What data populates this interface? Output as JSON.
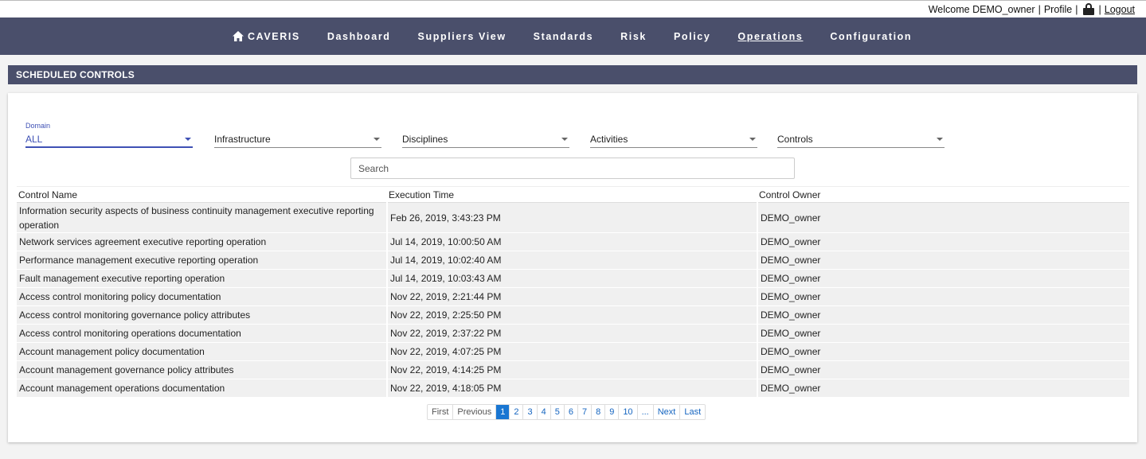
{
  "topbar": {
    "welcome": "Welcome DEMO_owner",
    "sep1": "|",
    "profile": "Profile",
    "sep2": "|",
    "sep3": "|",
    "logout": "Logout"
  },
  "nav": {
    "brand": "CAVERIS",
    "items": [
      {
        "label": "Dashboard"
      },
      {
        "label": "Suppliers View"
      },
      {
        "label": "Standards"
      },
      {
        "label": "Risk"
      },
      {
        "label": "Policy"
      },
      {
        "label": "Operations",
        "active": true
      },
      {
        "label": "Configuration"
      }
    ]
  },
  "section": {
    "title": "SCHEDULED CONTROLS"
  },
  "filters": {
    "domain": {
      "label": "Domain",
      "value": "ALL"
    },
    "infrastructure": {
      "value": "Infrastructure"
    },
    "disciplines": {
      "value": "Disciplines"
    },
    "activities": {
      "value": "Activities"
    },
    "controls": {
      "value": "Controls"
    }
  },
  "search": {
    "placeholder": "Search",
    "value": ""
  },
  "table": {
    "headers": [
      "Control Name",
      "Execution Time",
      "Control Owner"
    ],
    "rows": [
      [
        "Information security aspects of business continuity management executive reporting operation",
        "Feb 26, 2019, 3:43:23 PM",
        "DEMO_owner"
      ],
      [
        "Network services agreement executive reporting operation",
        "Jul 14, 2019, 10:00:50 AM",
        "DEMO_owner"
      ],
      [
        "Performance management executive reporting operation",
        "Jul 14, 2019, 10:02:40 AM",
        "DEMO_owner"
      ],
      [
        "Fault management executive reporting operation",
        "Jul 14, 2019, 10:03:43 AM",
        "DEMO_owner"
      ],
      [
        "Access control monitoring policy documentation",
        "Nov 22, 2019, 2:21:44 PM",
        "DEMO_owner"
      ],
      [
        "Access control monitoring governance policy attributes",
        "Nov 22, 2019, 2:25:50 PM",
        "DEMO_owner"
      ],
      [
        "Access control monitoring operations documentation",
        "Nov 22, 2019, 2:37:22 PM",
        "DEMO_owner"
      ],
      [
        "Account management policy documentation",
        "Nov 22, 2019, 4:07:25 PM",
        "DEMO_owner"
      ],
      [
        "Account management governance policy attributes",
        "Nov 22, 2019, 4:14:25 PM",
        "DEMO_owner"
      ],
      [
        "Account management operations documentation",
        "Nov 22, 2019, 4:18:05 PM",
        "DEMO_owner"
      ]
    ]
  },
  "pagination": {
    "first": "First",
    "previous": "Previous",
    "pages": [
      "1",
      "2",
      "3",
      "4",
      "5",
      "6",
      "7",
      "8",
      "9",
      "10"
    ],
    "current": "1",
    "ellipsis": "...",
    "next": "Next",
    "last": "Last"
  },
  "colors": {
    "nav_bg": "#4a4f6b",
    "accent": "#3f51b5",
    "page_active": "#1976d2"
  },
  "icons": {
    "brand": "home-icon",
    "topbar": "lock-icon"
  }
}
